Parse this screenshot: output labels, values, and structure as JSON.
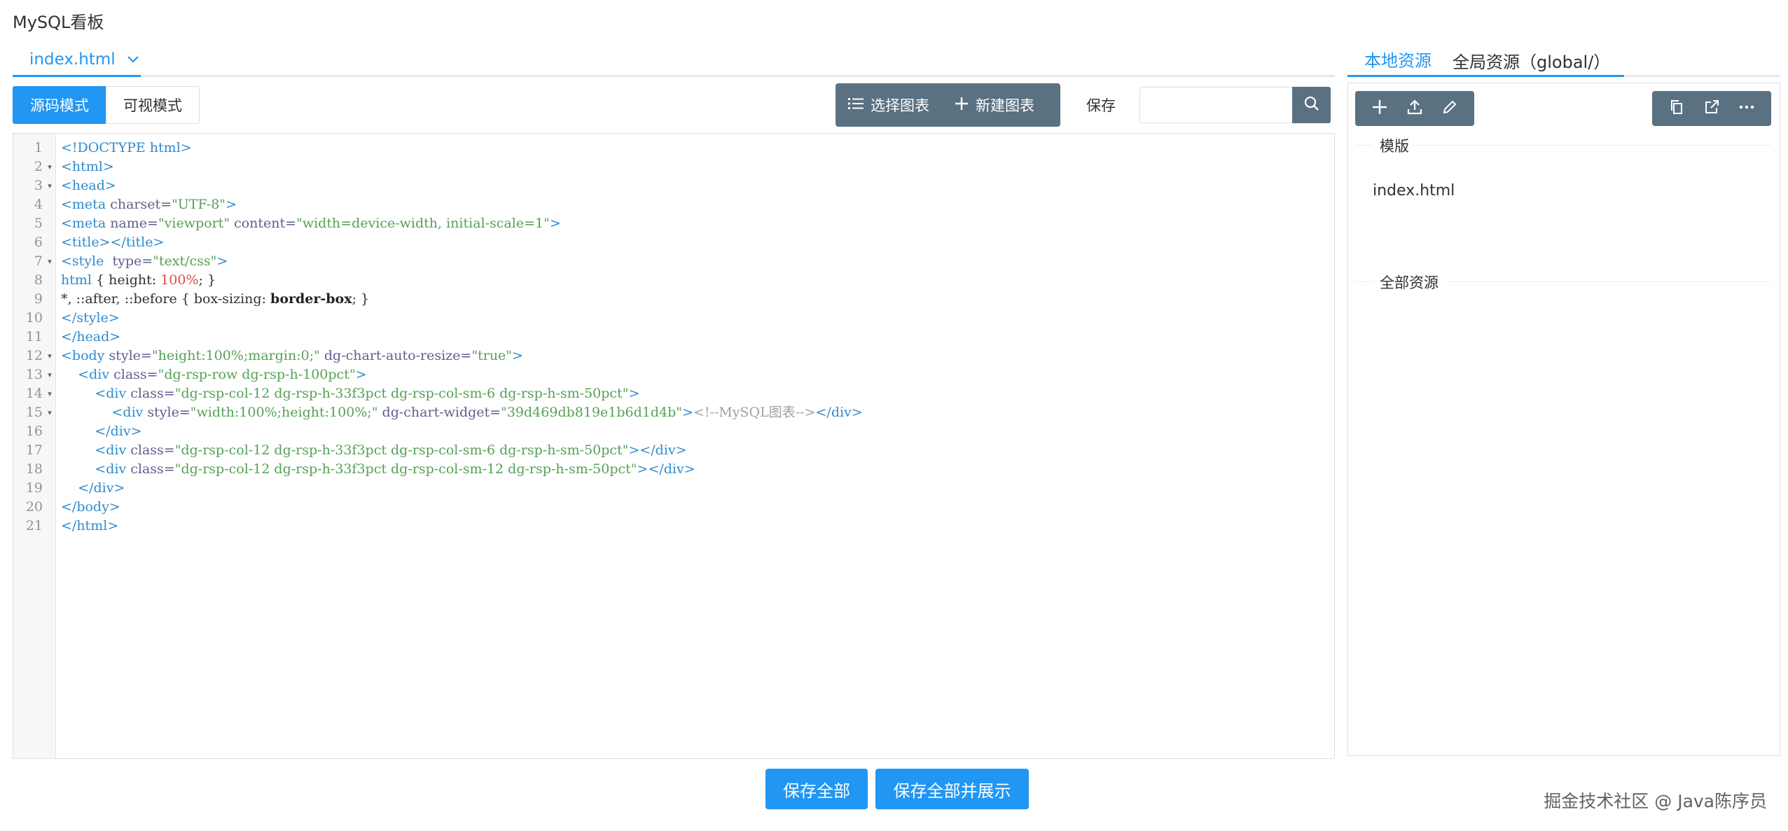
{
  "app": {
    "title": "MySQL看板"
  },
  "file_tab": {
    "label": "index.html"
  },
  "toolbar": {
    "source_mode": "源码模式",
    "visual_mode": "可视模式",
    "select_chart": "选择图表",
    "new_chart": "新建图表",
    "save": "保存",
    "search_placeholder": ""
  },
  "editor": {
    "lines": [
      {
        "n": "1",
        "fold": ""
      },
      {
        "n": "2",
        "fold": "▾"
      },
      {
        "n": "3",
        "fold": "▾"
      },
      {
        "n": "4",
        "fold": ""
      },
      {
        "n": "5",
        "fold": ""
      },
      {
        "n": "6",
        "fold": ""
      },
      {
        "n": "7",
        "fold": "▾"
      },
      {
        "n": "8",
        "fold": ""
      },
      {
        "n": "9",
        "fold": ""
      },
      {
        "n": "10",
        "fold": ""
      },
      {
        "n": "11",
        "fold": ""
      },
      {
        "n": "12",
        "fold": "▾"
      },
      {
        "n": "13",
        "fold": "▾"
      },
      {
        "n": "14",
        "fold": "▾"
      },
      {
        "n": "15",
        "fold": "▾"
      },
      {
        "n": "16",
        "fold": ""
      },
      {
        "n": "17",
        "fold": ""
      },
      {
        "n": "18",
        "fold": ""
      },
      {
        "n": "19",
        "fold": ""
      },
      {
        "n": "20",
        "fold": ""
      },
      {
        "n": "21",
        "fold": ""
      }
    ],
    "code": [
      [
        [
          "t",
          "<!DOCTYPE html>"
        ]
      ],
      [
        [
          "t",
          "<html>"
        ]
      ],
      [
        [
          "t",
          "<head>"
        ]
      ],
      [
        [
          "t",
          "<meta "
        ],
        [
          "a",
          "charset="
        ],
        [
          "s",
          "\"UTF-8\""
        ],
        [
          "t",
          ">"
        ]
      ],
      [
        [
          "t",
          "<meta "
        ],
        [
          "a",
          "name="
        ],
        [
          "s",
          "\"viewport\" "
        ],
        [
          "a",
          "content="
        ],
        [
          "s",
          "\"width=device-width, initial-scale=1\""
        ],
        [
          "t",
          ">"
        ]
      ],
      [
        [
          "t",
          "<title></title>"
        ]
      ],
      [
        [
          "t",
          "<style  "
        ],
        [
          "a",
          "type="
        ],
        [
          "s",
          "\"text/css\""
        ],
        [
          "t",
          ">"
        ]
      ],
      [
        [
          "t",
          "html "
        ],
        [
          "",
          "{ height: "
        ],
        [
          "n",
          "100%"
        ],
        [
          "",
          ";"
        ],
        [
          "",
          " }"
        ]
      ],
      [
        [
          "",
          "*, ::after, ::before { box-sizing: "
        ],
        [
          "b",
          "border-box"
        ],
        [
          "",
          "; }"
        ]
      ],
      [
        [
          "t",
          "</style>"
        ]
      ],
      [
        [
          "t",
          "</head>"
        ]
      ],
      [
        [
          "t",
          "<body "
        ],
        [
          "a",
          "style="
        ],
        [
          "s",
          "\"height:100%;margin:0;\" "
        ],
        [
          "a",
          "dg-chart-auto-resize="
        ],
        [
          "s",
          "\"true\""
        ],
        [
          "t",
          ">"
        ]
      ],
      [
        [
          "",
          "    "
        ],
        [
          "t",
          "<div "
        ],
        [
          "a",
          "class="
        ],
        [
          "s",
          "\"dg-rsp-row dg-rsp-h-100pct\""
        ],
        [
          "t",
          ">"
        ]
      ],
      [
        [
          "",
          "        "
        ],
        [
          "t",
          "<div "
        ],
        [
          "a",
          "class="
        ],
        [
          "s",
          "\"dg-rsp-col-12 dg-rsp-h-33f3pct dg-rsp-col-sm-6 dg-rsp-h-sm-50pct\""
        ],
        [
          "t",
          ">"
        ]
      ],
      [
        [
          "",
          "            "
        ],
        [
          "t",
          "<div "
        ],
        [
          "a",
          "style="
        ],
        [
          "s",
          "\"width:100%;height:100%;\" "
        ],
        [
          "a",
          "dg-chart-widget="
        ],
        [
          "s",
          "\"39d469db819e1b6d1d4b\""
        ],
        [
          "t",
          ">"
        ],
        [
          "cm",
          "<!--MySQL图表-->"
        ],
        [
          "t",
          "</div>"
        ]
      ],
      [
        [
          "",
          "        "
        ],
        [
          "t",
          "</div>"
        ]
      ],
      [
        [
          "",
          "        "
        ],
        [
          "t",
          "<div "
        ],
        [
          "a",
          "class="
        ],
        [
          "s",
          "\"dg-rsp-col-12 dg-rsp-h-33f3pct dg-rsp-col-sm-6 dg-rsp-h-sm-50pct\""
        ],
        [
          "t",
          "></div>"
        ]
      ],
      [
        [
          "",
          "        "
        ],
        [
          "t",
          "<div "
        ],
        [
          "a",
          "class="
        ],
        [
          "s",
          "\"dg-rsp-col-12 dg-rsp-h-33f3pct dg-rsp-col-sm-12 dg-rsp-h-sm-50pct\""
        ],
        [
          "t",
          "></div>"
        ]
      ],
      [
        [
          "",
          "    "
        ],
        [
          "t",
          "</div>"
        ]
      ],
      [
        [
          "t",
          "</body>"
        ]
      ],
      [
        [
          "t",
          "</html>"
        ]
      ]
    ]
  },
  "right_panel": {
    "tab_local": "本地资源",
    "tab_global": "全局资源（global/）",
    "section_templates": "模版",
    "template_item": "index.html",
    "section_all": "全部资源"
  },
  "bottom": {
    "save_all": "保存全部",
    "save_all_show": "保存全部并展示"
  },
  "watermark": "掘金技术社区 @ Java陈序员",
  "colors": {
    "accent": "#2196f3",
    "toolbar_dark": "#5a7182"
  }
}
